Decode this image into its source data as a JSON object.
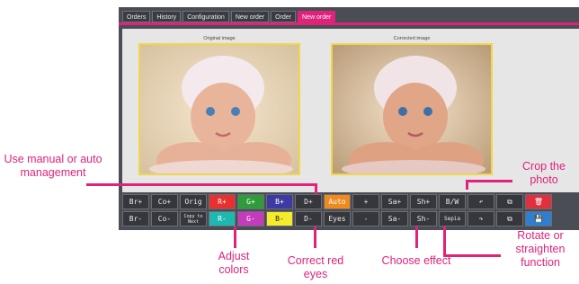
{
  "tabs": [
    "Orders",
    "History",
    "Configuration",
    "New order",
    "Order",
    "New order"
  ],
  "active_tab_index": 5,
  "captions": {
    "original": "Original image",
    "corrected": "Corrected image"
  },
  "row1": [
    {
      "label": "Br+",
      "bg": "#35373c",
      "fg": "#eaeaea"
    },
    {
      "label": "Co+",
      "bg": "#35373c",
      "fg": "#eaeaea"
    },
    {
      "label": "Orig",
      "bg": "#35373c",
      "fg": "#eaeaea"
    },
    {
      "label": "R+",
      "bg": "#e8302e",
      "fg": "#ffffff"
    },
    {
      "label": "G+",
      "bg": "#2f9b3a",
      "fg": "#ffffff"
    },
    {
      "label": "B+",
      "bg": "#3d3aa3",
      "fg": "#ffffff"
    },
    {
      "label": "D+",
      "bg": "#35373c",
      "fg": "#eaeaea"
    },
    {
      "label": "Auto",
      "bg": "#f08a1c",
      "fg": "#ffffff"
    },
    {
      "label": "+",
      "bg": "#35373c",
      "fg": "#eaeaea"
    },
    {
      "label": "Sa+",
      "bg": "#35373c",
      "fg": "#eaeaea"
    },
    {
      "label": "Sh+",
      "bg": "#35373c",
      "fg": "#eaeaea"
    },
    {
      "label": "B/W",
      "bg": "#35373c",
      "fg": "#eaeaea"
    },
    {
      "label": "↶",
      "bg": "#35373c",
      "fg": "#eaeaea"
    },
    {
      "label": "⧉",
      "bg": "#35373c",
      "fg": "#eaeaea"
    },
    {
      "label": "🗑",
      "bg": "#e03040",
      "fg": "#ffffff"
    }
  ],
  "row2": [
    {
      "label": "Br-",
      "bg": "#35373c",
      "fg": "#eaeaea"
    },
    {
      "label": "Co-",
      "bg": "#35373c",
      "fg": "#eaeaea"
    },
    {
      "label": "Copy to Next",
      "bg": "#35373c",
      "fg": "#eaeaea",
      "small": true
    },
    {
      "label": "R-",
      "bg": "#1fb8b0",
      "fg": "#ffffff"
    },
    {
      "label": "G-",
      "bg": "#c43bbd",
      "fg": "#ffffff"
    },
    {
      "label": "B-",
      "bg": "#f4ec2a",
      "fg": "#222222"
    },
    {
      "label": "D-",
      "bg": "#35373c",
      "fg": "#eaeaea"
    },
    {
      "label": "Eyes",
      "bg": "#35373c",
      "fg": "#eaeaea"
    },
    {
      "label": "-",
      "bg": "#35373c",
      "fg": "#eaeaea"
    },
    {
      "label": "Sa-",
      "bg": "#35373c",
      "fg": "#eaeaea"
    },
    {
      "label": "Sh-",
      "bg": "#35373c",
      "fg": "#eaeaea"
    },
    {
      "label": "Sepia",
      "bg": "#35373c",
      "fg": "#eaeaea",
      "tiny": true
    },
    {
      "label": "↷",
      "bg": "#35373c",
      "fg": "#eaeaea"
    },
    {
      "label": "⧉",
      "bg": "#35373c",
      "fg": "#eaeaea"
    },
    {
      "label": "💾",
      "bg": "#2f7fd0",
      "fg": "#ffffff"
    }
  ],
  "annotations": {
    "manual": "Use manual or auto management",
    "colors": "Adjust colors",
    "eyes": "Correct red eyes",
    "effect": "Choose effect",
    "rotate": "Rotate or straighten function",
    "crop": "Crop the photo"
  },
  "accent": "#e0227b"
}
